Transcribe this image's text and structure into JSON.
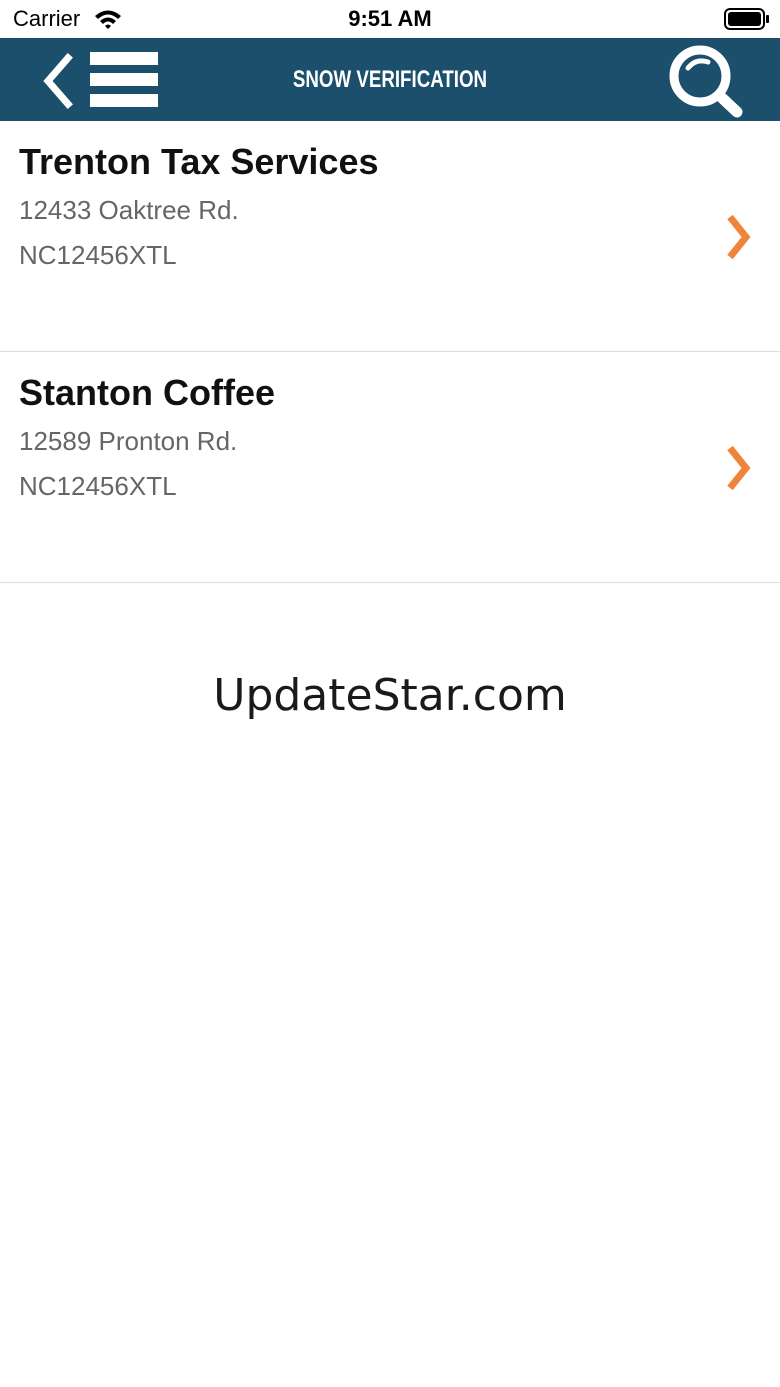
{
  "status_bar": {
    "carrier": "Carrier",
    "time": "9:51 AM",
    "icons": [
      "wifi-icon",
      "battery-icon"
    ]
  },
  "nav": {
    "title": "SNOW VERIFICATION",
    "icons": [
      "back-chevron-icon",
      "menu-icon",
      "search-icon"
    ],
    "background": "#1c4f6c"
  },
  "list": {
    "items": [
      {
        "name": "Trenton Tax Services",
        "address": "12433 Oaktree Rd.",
        "code": "NC12456XTL"
      },
      {
        "name": "Stanton Coffee",
        "address": "12589 Pronton Rd.",
        "code": "NC12456XTL"
      }
    ],
    "chevron_color": "#f0843a"
  },
  "watermark": "UpdateStar.com"
}
